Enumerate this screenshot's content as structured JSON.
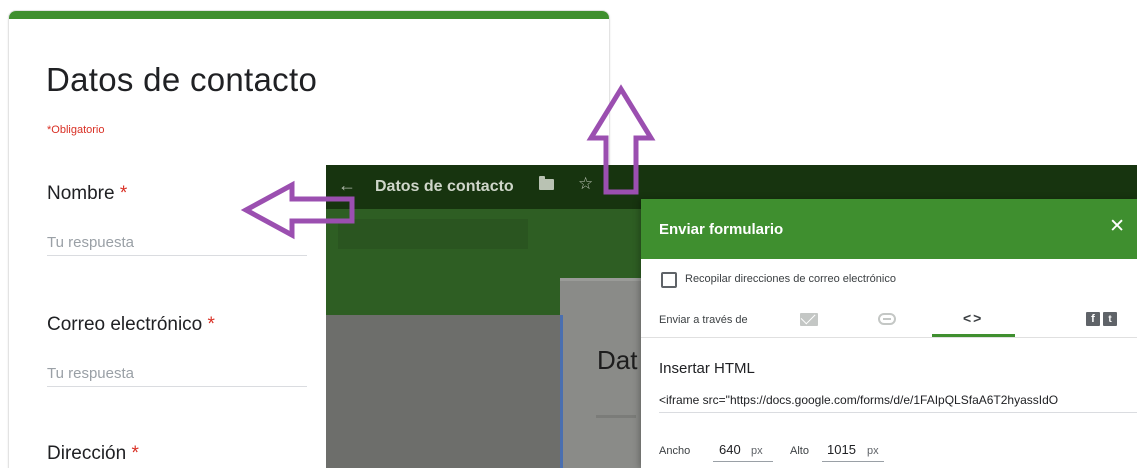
{
  "form": {
    "title": "Datos de contacto",
    "required_note": "*Obligatorio",
    "questions": [
      {
        "label": "Nombre",
        "required_mark": "*",
        "placeholder": "Tu respuesta"
      },
      {
        "label": "Correo electrónico",
        "required_mark": "*",
        "placeholder": "Tu respuesta"
      },
      {
        "label": "Dirección",
        "required_mark": "*"
      }
    ],
    "accent_color": "#3f8f2f"
  },
  "editor": {
    "back_icon": "arrow-left-icon",
    "title": "Datos de contacto",
    "folder_icon": "folder-icon",
    "star_icon": "star-icon",
    "preview_title": "Dat"
  },
  "dialog": {
    "title": "Enviar formulario",
    "close_icon": "close-icon",
    "collect_emails_label": "Recopilar direcciones de correo electrónico",
    "collect_emails_checked": false,
    "send_via_label": "Enviar a través de",
    "tabs": [
      {
        "icon": "email-icon",
        "active": false
      },
      {
        "icon": "link-icon",
        "active": false
      },
      {
        "icon": "embed-code-icon",
        "label": "<>",
        "active": true
      }
    ],
    "social": [
      "facebook-icon",
      "twitter-icon"
    ],
    "section_title": "Insertar HTML",
    "embed_code": "<iframe src=\"https://docs.google.com/forms/d/e/1FAIpQLSfaA6T2hyassIdO",
    "width_label": "Ancho",
    "width_value": "640",
    "width_unit": "px",
    "height_label": "Alto",
    "height_value": "1015",
    "height_unit": "px",
    "header_color": "#3f8f2f"
  },
  "annotations": {
    "arrow_color": "#9b4fb0",
    "arrows": [
      "left-arrow",
      "up-arrow"
    ]
  }
}
